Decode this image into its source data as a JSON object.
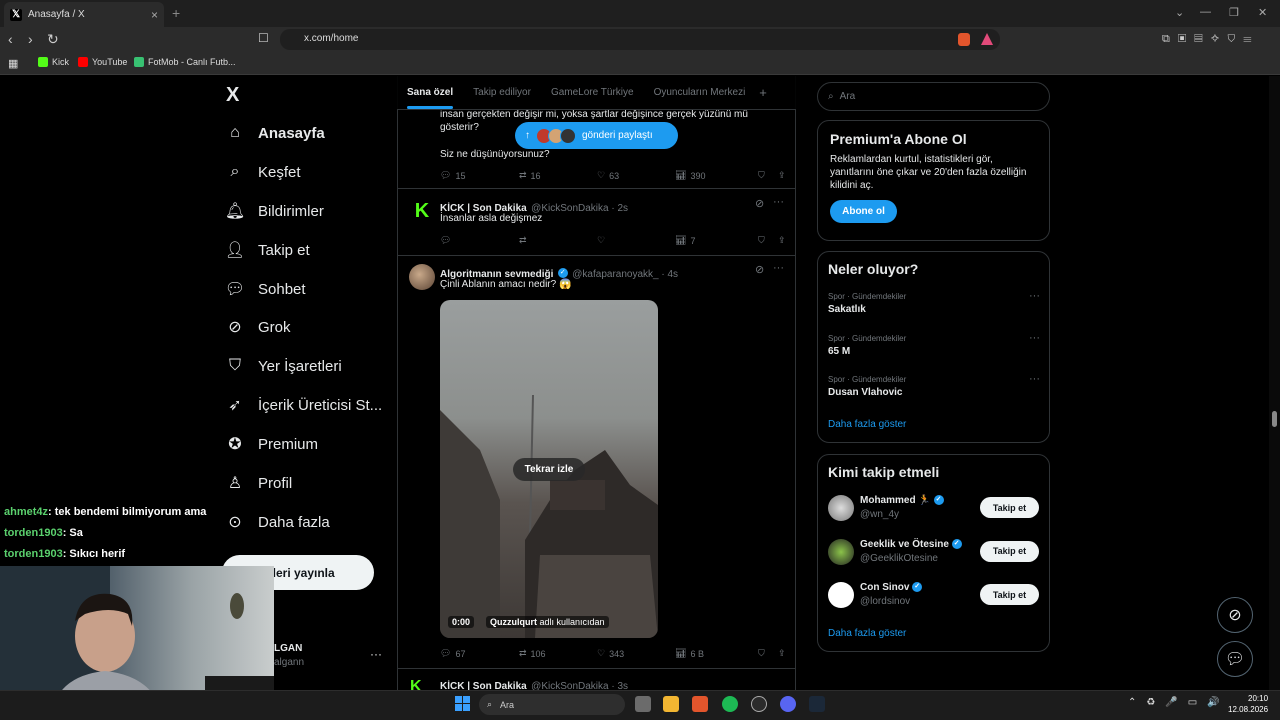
{
  "browser": {
    "tab_title": "Anasayfa / X",
    "url": "x.com/home",
    "bookmarks": [
      "Kick",
      "YouTube",
      "FotMob - Canlı Futb..."
    ]
  },
  "sidebar": {
    "logo": "X",
    "items": [
      {
        "label": "Anasayfa",
        "icon": "home-icon"
      },
      {
        "label": "Keşfet",
        "icon": "search-icon"
      },
      {
        "label": "Bildirimler",
        "icon": "bell-icon"
      },
      {
        "label": "Takip et",
        "icon": "person-plus-icon"
      },
      {
        "label": "Sohbet",
        "icon": "chat-icon"
      },
      {
        "label": "Grok",
        "icon": "grok-icon"
      },
      {
        "label": "Yer İşaretleri",
        "icon": "bookmark-icon"
      },
      {
        "label": "İçerik Üreticisi St...",
        "icon": "rocket-icon"
      },
      {
        "label": "Premium",
        "icon": "verified-icon"
      },
      {
        "label": "Profil",
        "icon": "person-icon"
      },
      {
        "label": "Daha fazla",
        "icon": "more-circle-icon"
      }
    ],
    "post_button": "nderi yayınla",
    "account_name": "LGAN",
    "account_handle": "algann"
  },
  "feed_tabs": [
    "Sana özel",
    "Takip ediliyor",
    "GameLore Türkiye",
    "Oyuncuların Merkezi"
  ],
  "share_pill": "gönderi paylaştı",
  "tweets": [
    {
      "text1": "insan gerçekten değişir mi, yoksa şartlar değişince gerçek yüzünü mü",
      "text2": "gösterir?",
      "text3": "Siz ne düşünüyorsunuz?",
      "replies": "15",
      "retweets": "16",
      "likes": "63",
      "views": "390"
    },
    {
      "name": "KİCK | Son Dakika",
      "handle": "@KickSonDakika · 2s",
      "text": "İnsanlar asla değişmez",
      "replies": "",
      "retweets": "",
      "likes": "",
      "views": "7"
    },
    {
      "name": "Algoritmanın sevmediği",
      "handle": "@kafaparanoyakk_ · 4s",
      "text": "Çinli Ablanın amacı nedir? 😱",
      "video_button": "Tekrar izle",
      "video_time": "0:00",
      "video_user": "Quzzulqurt",
      "video_user_suffix": "adlı kullanıcıdan",
      "replies": "67",
      "retweets": "106",
      "likes": "343",
      "views": "6 B"
    },
    {
      "name": "KİCK | Son Dakika",
      "handle": "@KickSonDakika · 3s"
    }
  ],
  "right": {
    "search_placeholder": "Ara",
    "premium": {
      "title": "Premium'a Abone Ol",
      "body": "Reklamlardan kurtul, istatistikleri gör, yanıtlarını öne çıkar ve 20'den fazla özelliğin kilidini aç.",
      "button": "Abone ol"
    },
    "trends": {
      "title": "Neler oluyor?",
      "items": [
        {
          "category": "Spor · Gündemdekiler",
          "name": "Sakatlık"
        },
        {
          "category": "Spor · Gündemdekiler",
          "name": "65 M"
        },
        {
          "category": "Spor · Gündemdekiler",
          "name": "Dusan Vlahovic"
        }
      ],
      "more": "Daha fazla göster"
    },
    "who_to_follow": {
      "title": "Kimi takip etmeli",
      "items": [
        {
          "name": "Mohammed 🏃",
          "handle": "@wn_4y",
          "button": "Takip et"
        },
        {
          "name": "Geeklik ve Ötesine",
          "handle": "@GeeklikOtesine",
          "button": "Takip et"
        },
        {
          "name": "Con Sinov",
          "handle": "@lordsinov",
          "button": "Takip et"
        }
      ],
      "more": "Daha fazla göster"
    }
  },
  "stream_chat": [
    {
      "user": "ahmet4z",
      "msg": ": tek bendemi bilmiyorum ama"
    },
    {
      "user": "torden1903",
      "msg": ": Sa"
    },
    {
      "user": "torden1903",
      "msg": ": Sıkıcı herif"
    }
  ],
  "taskbar": {
    "search": "Ara",
    "time": "20:10",
    "date": "12.08.2026"
  },
  "colors": {
    "accent": "#1d9bf0",
    "bg": "#000000",
    "border": "#2f3336",
    "muted": "#71767b"
  }
}
